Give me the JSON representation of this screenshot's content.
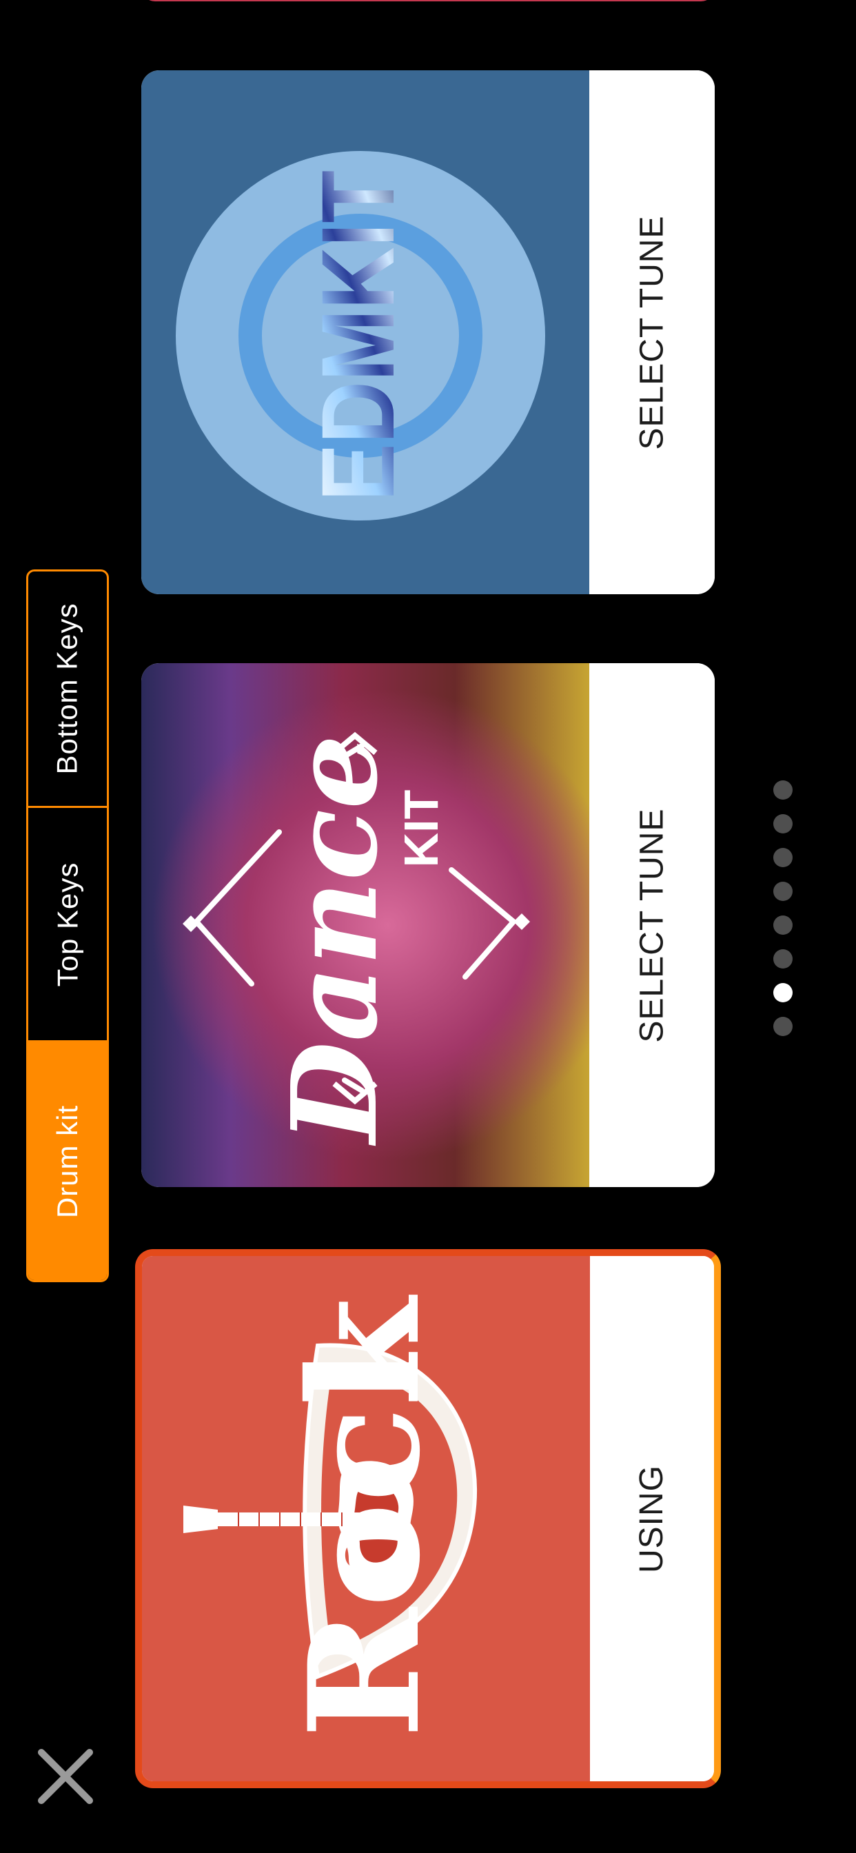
{
  "tabs": [
    {
      "label": "Drum kit",
      "active": true
    },
    {
      "label": "Top Keys",
      "active": false
    },
    {
      "label": "Bottom Keys",
      "active": false
    }
  ],
  "cards": {
    "edm": {
      "logo_text": "EDMKIT",
      "button_label": "SELECT TUNE"
    },
    "dance": {
      "logo_text": "Dance",
      "logo_subtext": "KIT",
      "button_label": "SELECT TUNE"
    },
    "rock": {
      "logo_text": "Rock",
      "button_label": "USING"
    }
  },
  "pagination": {
    "total": 8,
    "active_index_from_top": 6
  },
  "icons": {
    "close": "close-icon",
    "guitar": "guitar-icon"
  },
  "colors": {
    "accent": "#ff8a00",
    "edm_bg": "#3a6893",
    "rock_bg": "#d95745",
    "rock_border": "#e44a1a"
  }
}
